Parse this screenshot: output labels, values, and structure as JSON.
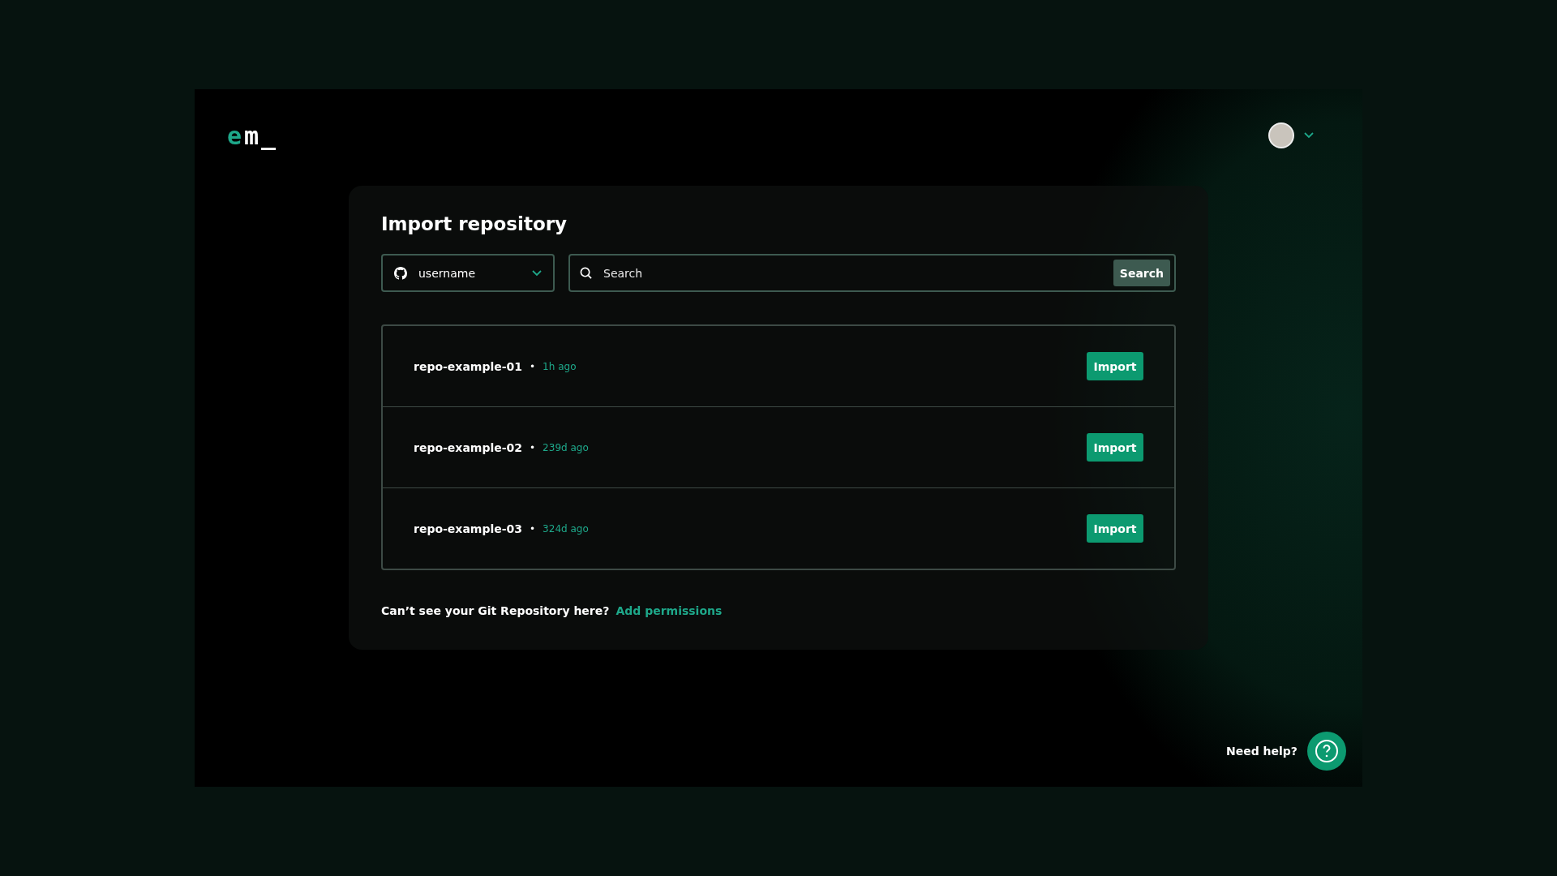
{
  "logo": {
    "accent": "e",
    "rest": "m_"
  },
  "title": "Import repository",
  "account_select": {
    "value": "username"
  },
  "search": {
    "placeholder": "Search",
    "button": "Search"
  },
  "repositories": [
    {
      "name": "repo-example-01",
      "separator": "•",
      "updated": "1h ago",
      "action": "Import"
    },
    {
      "name": "repo-example-02",
      "separator": "•",
      "updated": "239d ago",
      "action": "Import"
    },
    {
      "name": "repo-example-03",
      "separator": "•",
      "updated": "324d ago",
      "action": "Import"
    }
  ],
  "footer": {
    "question": "Can’t see your Git Repository here?",
    "link": "Add permissions"
  },
  "help": {
    "label": "Need help?"
  }
}
